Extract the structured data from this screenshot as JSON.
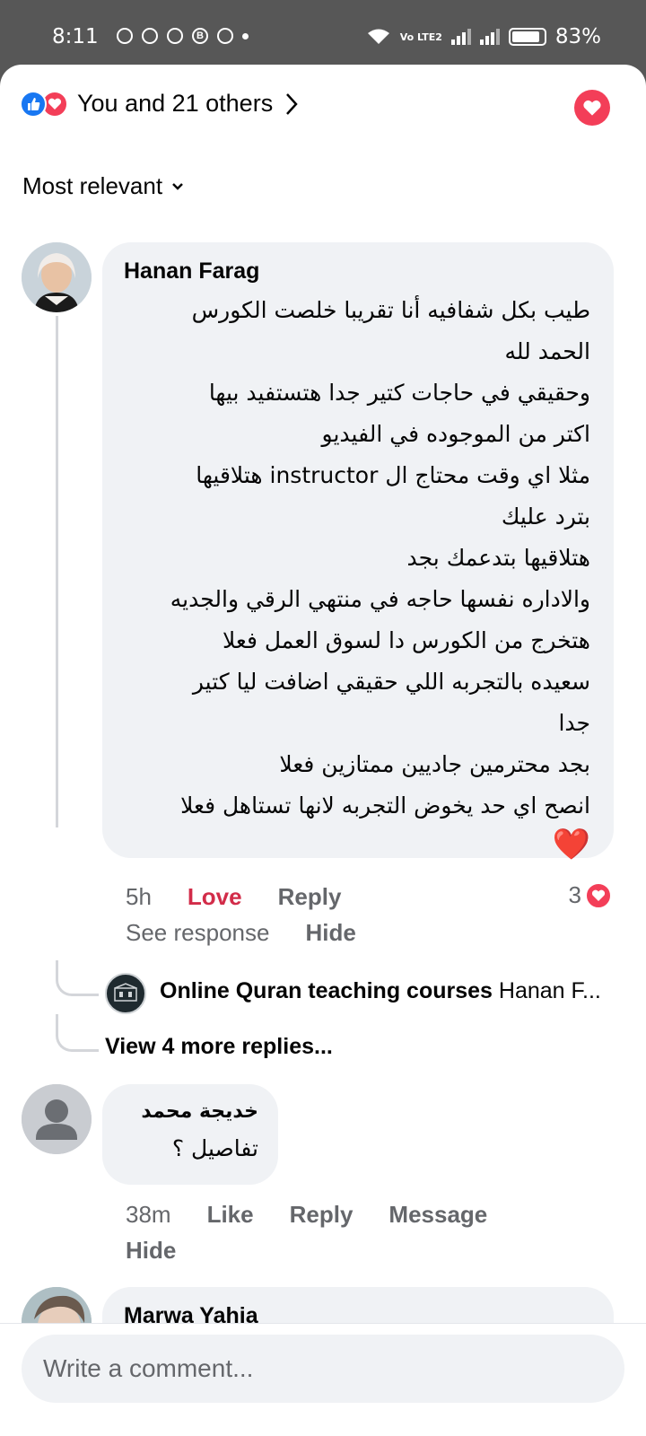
{
  "status_bar": {
    "time": "8:11",
    "battery": "83%",
    "network": "Vo LTE2"
  },
  "header": {
    "reactors_text": "You and 21 others"
  },
  "sort": {
    "label": "Most relevant"
  },
  "comments": [
    {
      "author": "Hanan Farag",
      "lines": [
        "طيب بكل شفافيه أنا تقريبا خلصت الكورس",
        "الحمد لله",
        "وحقيقي في حاجات كتير جدا هتستفيد بيها",
        "اكتر من الموجوده في الفيديو",
        "مثلا اي وقت محتاج ال instructor هتلاقيها",
        "بترد عليك",
        "هتلاقيها بتدعمك بجد",
        "والاداره نفسها حاجه في منتهي الرقي والجديه",
        "هتخرج من الكورس دا لسوق العمل فعلا",
        "سعيده بالتجربه اللي حقيقي اضافت ليا كتير",
        "جدا",
        "بجد محترمين جاديين ممتازين فعلا",
        "انصح اي حد يخوض التجربه لانها تستاهل فعلا"
      ],
      "emoji": "❤️",
      "time": "5h",
      "reaction_label": "Love",
      "reply_label": "Reply",
      "reaction_count": "3",
      "see_response": "See response",
      "hide": "Hide",
      "reply_preview": {
        "author": "Online Quran teaching courses",
        "text": "Hanan F..."
      },
      "view_more": "View 4 more replies..."
    },
    {
      "author": "خديجة محمد",
      "text": "تفاصيل ؟",
      "time": "38m",
      "like_label": "Like",
      "reply_label": "Reply",
      "message_label": "Message",
      "hide": "Hide"
    },
    {
      "author": "Marwa Yahia"
    }
  ],
  "composer": {
    "placeholder": "Write a comment..."
  },
  "colors": {
    "love": "#f33e58",
    "like": "#1877f2",
    "love_text": "#d22c49",
    "bubble": "#f0f2f5"
  }
}
